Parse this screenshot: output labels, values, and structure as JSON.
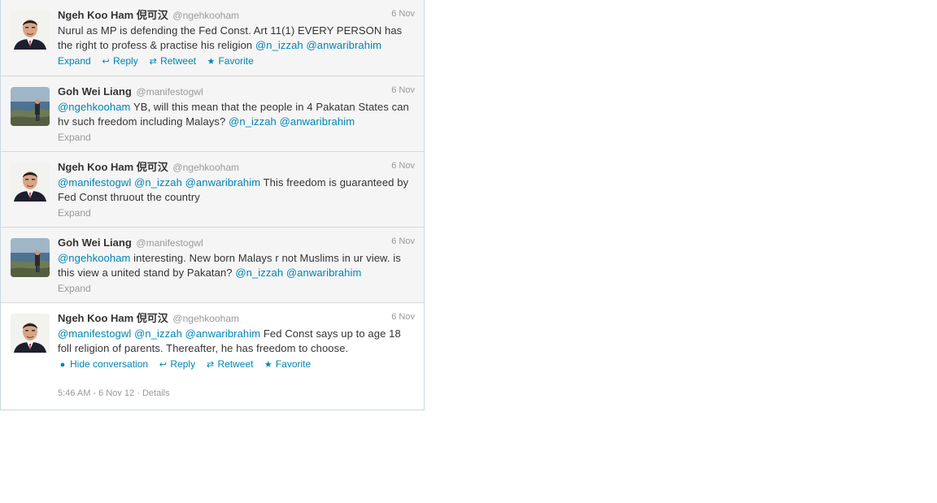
{
  "tweets": [
    {
      "name": "Ngeh Koo Ham 倪可汉",
      "handle": "@ngehkooham",
      "time": "6 Nov",
      "avatar": "portrait-man-avatar",
      "parts": [
        {
          "t": "Nurul as MP is defending the Fed Const. Art 11(1) EVERY PERSON has the right to profess & practise his religion ",
          "m": false
        },
        {
          "t": "@n_izzah",
          "m": true
        },
        {
          "t": " ",
          "m": false
        },
        {
          "t": "@anwaribrahim",
          "m": true
        }
      ],
      "actions": [
        {
          "label": "Expand"
        },
        {
          "icon": "reply-icon",
          "glyph": "↩",
          "label": "Reply"
        },
        {
          "icon": "retweet-icon",
          "glyph": "⇄",
          "label": "Retweet"
        },
        {
          "icon": "star-icon",
          "glyph": "★",
          "label": "Favorite"
        }
      ]
    },
    {
      "name": "Goh Wei Liang",
      "handle": "@manifestogwl",
      "time": "6 Nov",
      "avatar": "landscape-person-avatar",
      "parts": [
        {
          "t": "@ngehkooham",
          "m": true
        },
        {
          "t": " YB, will this mean that the people in 4 Pakatan States can hv such freedom including Malays? ",
          "m": false
        },
        {
          "t": "@n_izzah",
          "m": true
        },
        {
          "t": " ",
          "m": false
        },
        {
          "t": "@anwaribrahim",
          "m": true
        }
      ],
      "expand_label": "Expand"
    },
    {
      "name": "Ngeh Koo Ham 倪可汉",
      "handle": "@ngehkooham",
      "time": "6 Nov",
      "avatar": "portrait-man-avatar",
      "parts": [
        {
          "t": "@manifestogwl",
          "m": true
        },
        {
          "t": " ",
          "m": false
        },
        {
          "t": "@n_izzah",
          "m": true
        },
        {
          "t": " ",
          "m": false
        },
        {
          "t": "@anwaribrahim",
          "m": true
        },
        {
          "t": " This freedom is guaranteed by Fed Const thruout the country",
          "m": false
        }
      ],
      "expand_label": "Expand"
    },
    {
      "name": "Goh Wei Liang",
      "handle": "@manifestogwl",
      "time": "6 Nov",
      "avatar": "landscape-person-avatar",
      "parts": [
        {
          "t": "@ngehkooham",
          "m": true
        },
        {
          "t": " interesting. New born Malays r not Muslims in ur view. is this view a united stand by Pakatan? ",
          "m": false
        },
        {
          "t": "@n_izzah",
          "m": true
        },
        {
          "t": " ",
          "m": false
        },
        {
          "t": "@anwaribrahim",
          "m": true
        }
      ],
      "expand_label": "Expand"
    },
    {
      "name": "Ngeh Koo Ham 倪可汉",
      "handle": "@ngehkooham",
      "time": "6 Nov",
      "avatar": "portrait-man-avatar",
      "parts": [
        {
          "t": "@manifestogwl",
          "m": true
        },
        {
          "t": " ",
          "m": false
        },
        {
          "t": "@n_izzah",
          "m": true
        },
        {
          "t": " ",
          "m": false
        },
        {
          "t": "@anwaribrahim",
          "m": true
        },
        {
          "t": " Fed Const says up to age 18 foll religion of parents. Thereafter, he has freedom to choose.",
          "m": false
        }
      ],
      "actions": [
        {
          "icon": "speech-bubble-icon",
          "glyph": "●",
          "label": "Hide conversation"
        },
        {
          "icon": "reply-icon",
          "glyph": "↩",
          "label": "Reply"
        },
        {
          "icon": "retweet-icon",
          "glyph": "⇄",
          "label": "Retweet"
        },
        {
          "icon": "star-icon",
          "glyph": "★",
          "label": "Favorite"
        }
      ],
      "meta": {
        "timestamp": "5:46 AM - 6 Nov 12",
        "separator": " · ",
        "details": "Details"
      }
    }
  ],
  "colors": {
    "link": "#0084b4",
    "muted": "#999999",
    "text": "#333333",
    "row_bg": "#f5f5f5"
  }
}
